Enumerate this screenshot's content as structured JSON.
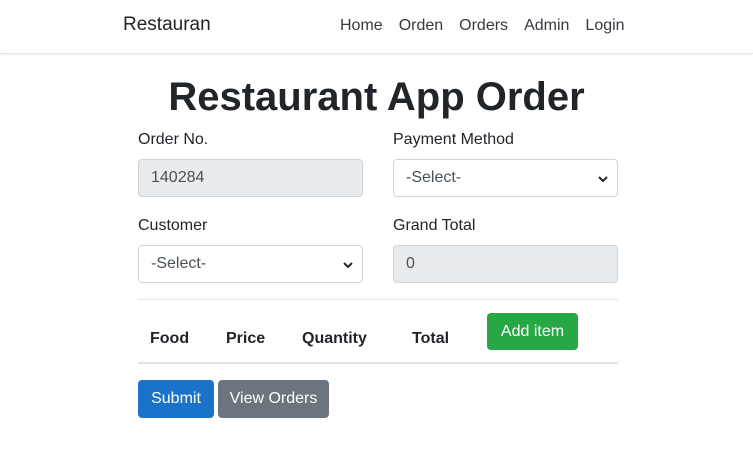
{
  "navbar": {
    "brand": "Restauran",
    "links": [
      "Home",
      "Orden",
      "Orders",
      "Admin",
      "Login"
    ]
  },
  "page": {
    "title": "Restaurant App Order"
  },
  "form": {
    "order_no": {
      "label": "Order No.",
      "value": "140284"
    },
    "payment_method": {
      "label": "Payment Method",
      "selected": "-Select-"
    },
    "customer": {
      "label": "Customer",
      "selected": "-Select-"
    },
    "grand_total": {
      "label": "Grand Total",
      "value": "0"
    }
  },
  "table": {
    "headers": [
      "Food",
      "Price",
      "Quantity",
      "Total"
    ],
    "add_item_label": "Add item"
  },
  "actions": {
    "submit_label": "Submit",
    "view_orders_label": "View Orders"
  },
  "colors": {
    "add_item": "#28a745",
    "submit": "#1a73c8",
    "view_orders": "#6c757d",
    "readonly_bg": "#e9ecef"
  }
}
